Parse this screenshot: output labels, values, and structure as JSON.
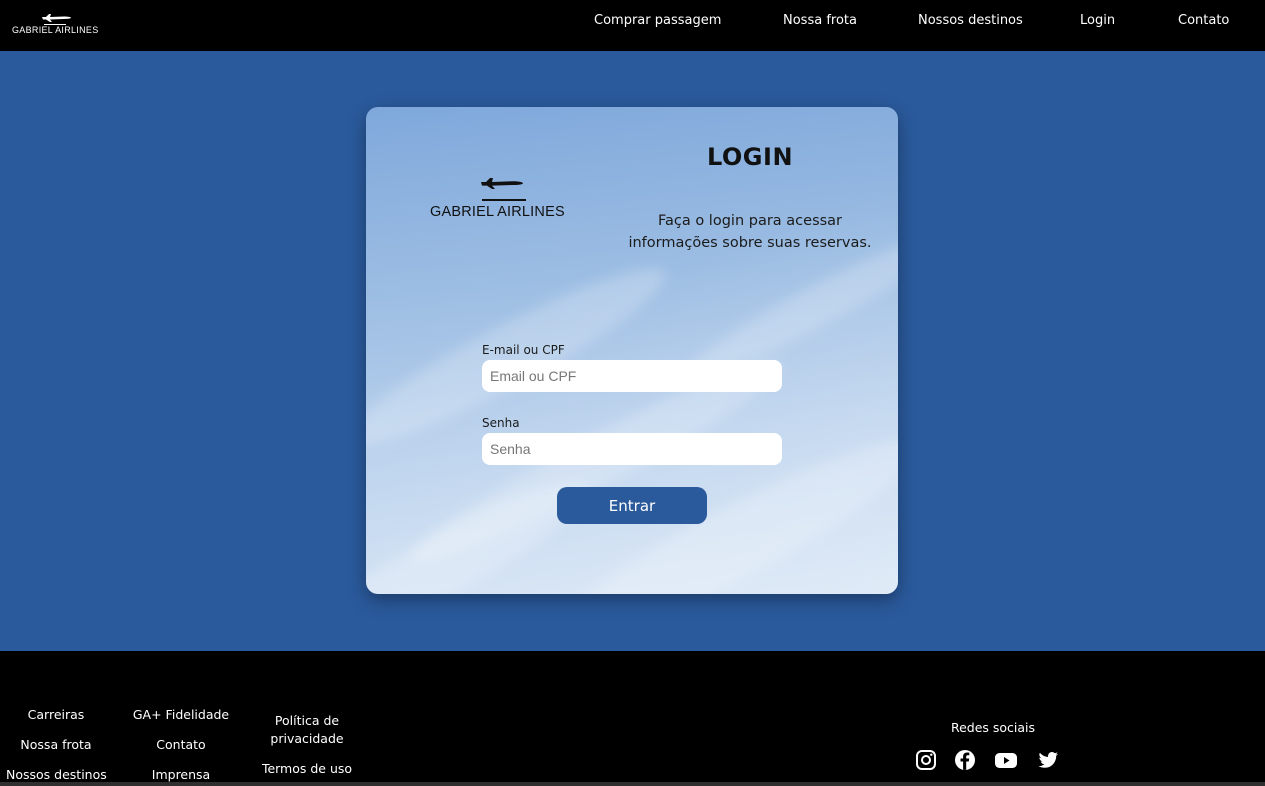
{
  "header": {
    "brand": "GABRIEL AIRLINES",
    "nav": [
      "Comprar passagem",
      "Nossa frota",
      "Nossos destinos",
      "Login",
      "Contato"
    ]
  },
  "login": {
    "logo_text": "GABRIEL AIRLINES",
    "title": "LOGIN",
    "subtitle": "Faça o login para acessar informações sobre suas reservas.",
    "email_label": "E-mail ou CPF",
    "email_placeholder": "Email ou CPF",
    "password_label": "Senha",
    "password_placeholder": "Senha",
    "submit_label": "Entrar"
  },
  "footer": {
    "col1": [
      "Carreiras",
      "Nossa frota",
      "Nossos destinos"
    ],
    "col2": [
      "GA+ Fidelidade",
      "Contato",
      "Imprensa"
    ],
    "col3": [
      "Política de privacidade",
      "Termos de uso"
    ],
    "social_title": "Redes sociais",
    "social_icons": [
      "instagram-icon",
      "facebook-icon",
      "youtube-icon",
      "twitter-icon"
    ]
  },
  "colors": {
    "primary_blue": "#2a5a9c",
    "header_footer_bg": "#000000",
    "card_sky": "#9cbde3"
  }
}
